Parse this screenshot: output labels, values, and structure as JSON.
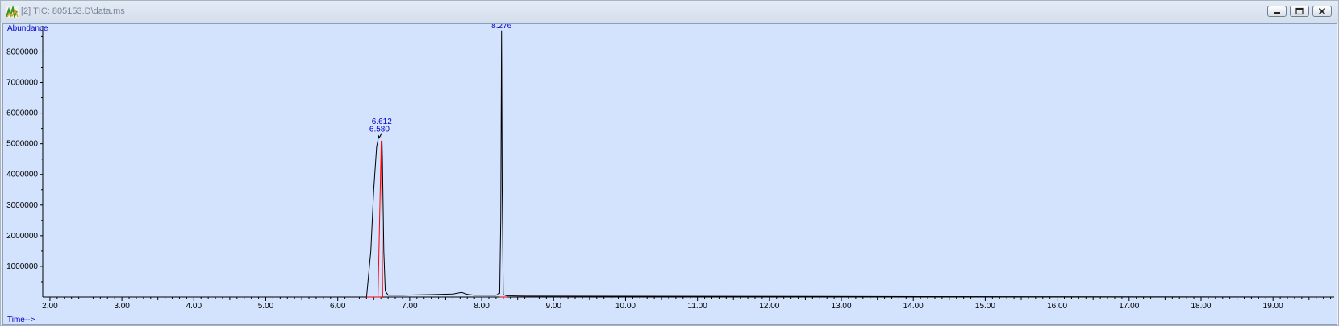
{
  "window": {
    "title": "[2] TIC: 805153.D\\data.ms",
    "buttons": [
      "minimize",
      "restore",
      "close"
    ]
  },
  "colors": {
    "plot_bg": "#d3e2fd",
    "trace": "#000000",
    "baseline": "#ff0000",
    "label": "#0000cc"
  },
  "icons": {
    "app": "chromatogram-app-icon",
    "minimize": "minimize-icon",
    "restore": "restore-icon",
    "close": "close-icon"
  },
  "chart_data": {
    "type": "line",
    "ylabel": "Abundance",
    "xlabel": "Time-->",
    "xlim": [
      1.9,
      19.85
    ],
    "ylim": [
      0,
      8800000
    ],
    "x_ticks": [
      "2.00",
      "3.00",
      "4.00",
      "5.00",
      "6.00",
      "7.00",
      "8.00",
      "9.00",
      "10.00",
      "11.00",
      "12.00",
      "13.00",
      "14.00",
      "15.00",
      "16.00",
      "17.00",
      "18.00",
      "19.00"
    ],
    "y_ticks": [
      "1000000",
      "2000000",
      "3000000",
      "4000000",
      "5000000",
      "6000000",
      "7000000",
      "8000000"
    ],
    "x_tick_values": [
      2,
      3,
      4,
      5,
      6,
      7,
      8,
      9,
      10,
      11,
      12,
      13,
      14,
      15,
      16,
      17,
      18,
      19
    ],
    "y_tick_values": [
      1000000,
      2000000,
      3000000,
      4000000,
      5000000,
      6000000,
      7000000,
      8000000
    ],
    "series": [
      {
        "x": [
          1.95,
          6.4,
          6.46,
          6.5,
          6.54,
          6.57,
          6.58,
          6.6,
          6.612,
          6.62,
          6.64,
          6.66,
          6.7,
          6.9,
          7.3,
          7.6,
          7.72,
          7.8,
          7.9,
          8.2,
          8.25,
          8.265,
          8.276,
          8.285,
          8.3,
          8.35,
          8.6,
          19.85
        ],
        "y": [
          0,
          0,
          1500000,
          3500000,
          4900000,
          5250000,
          5200000,
          5300000,
          5350000,
          4600000,
          1500000,
          200000,
          60000,
          60000,
          80000,
          100000,
          150000,
          90000,
          60000,
          60000,
          120000,
          2500000,
          8700000,
          3500000,
          80000,
          40000,
          30000,
          0
        ]
      }
    ],
    "baselines": [
      {
        "x": [
          6.56,
          6.605,
          6.625
        ],
        "y": [
          0,
          5100000,
          0
        ]
      },
      {
        "x": [
          6.4,
          6.62
        ],
        "y": [
          0,
          0
        ]
      },
      {
        "x": [
          8.25,
          8.35
        ],
        "y": [
          0,
          0
        ]
      }
    ],
    "peak_labels": [
      {
        "text": "6.612",
        "x": 6.612,
        "y": 5650000
      },
      {
        "text": "6.580",
        "x": 6.58,
        "y": 5400000
      },
      {
        "text": "8.276",
        "x": 8.276,
        "y": 8780000
      }
    ]
  }
}
